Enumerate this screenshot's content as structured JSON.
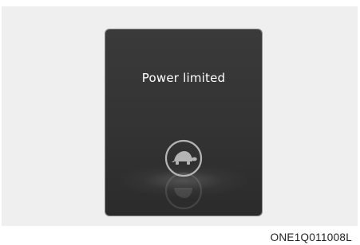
{
  "display": {
    "message": "Power limited",
    "icon": "turtle-icon"
  },
  "figure": {
    "code": "ONE1Q011008L"
  },
  "colors": {
    "display_bg": "#333333",
    "icon_stroke": "#b4b4b4",
    "text": "#ffffff"
  }
}
